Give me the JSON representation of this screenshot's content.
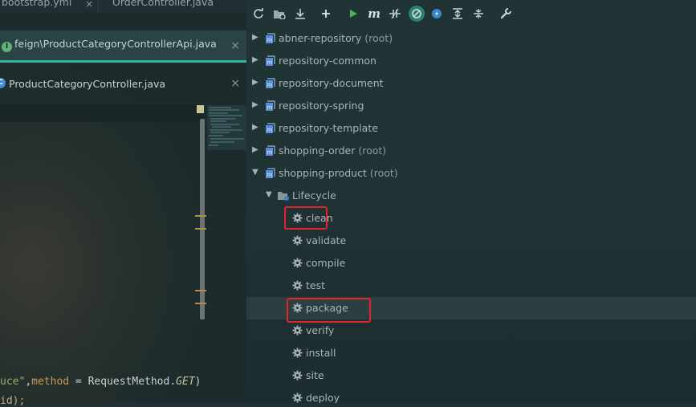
{
  "tabs": {
    "row1": [
      {
        "label": "bootstrap.yml"
      },
      {
        "label": "OrderController.java"
      }
    ],
    "active": {
      "label": "feign\\ProductCategoryControllerApi.java",
      "icon": "interface-icon"
    },
    "third": {
      "label": "ProductCategoryController.java",
      "icon": "class-icon"
    }
  },
  "code": {
    "line1_str": "uce\"",
    "line1_mid": ",",
    "line1_kw": "method",
    "line1_eq": " = RequestMethod.",
    "line1_const": "GET",
    "line1_end": ")",
    "line2": "id);"
  },
  "toolbar": [
    {
      "name": "reimport-icon"
    },
    {
      "name": "generate-sources-icon"
    },
    {
      "name": "download-icon"
    },
    {
      "name": "add-icon"
    },
    {
      "name": "run-icon"
    },
    {
      "name": "maven-goal-icon"
    },
    {
      "name": "toggle-offline-icon"
    },
    {
      "name": "toggle-skip-tests-icon"
    },
    {
      "name": "show-dependencies-icon"
    },
    {
      "name": "expand-all-icon"
    },
    {
      "name": "collapse-all-icon"
    },
    {
      "name": "settings-wrench-icon"
    }
  ],
  "projects": [
    {
      "label": "abner-repository",
      "suffix": "(root)"
    },
    {
      "label": "repository-common",
      "suffix": ""
    },
    {
      "label": "repository-document",
      "suffix": ""
    },
    {
      "label": "repository-spring",
      "suffix": ""
    },
    {
      "label": "repository-template",
      "suffix": ""
    },
    {
      "label": "shopping-order",
      "suffix": "(root)"
    },
    {
      "label": "shopping-product",
      "suffix": "(root)"
    }
  ],
  "lifecycle": {
    "label": "Lifecycle",
    "goals": [
      "clean",
      "validate",
      "compile",
      "test",
      "package",
      "verify",
      "install",
      "site",
      "deploy"
    ]
  },
  "colors": {
    "accent": "#2fb5a0",
    "highlight_box": "#e0262a",
    "maven_icon": "#5b8fd6"
  }
}
